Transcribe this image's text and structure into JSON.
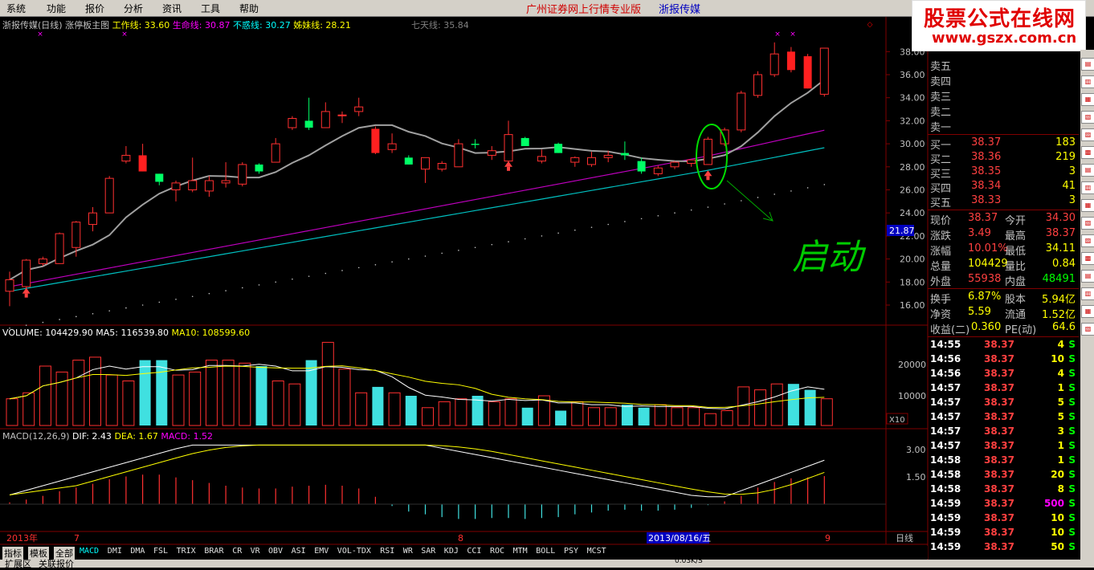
{
  "menu": [
    "系统",
    "功能",
    "报价",
    "分析",
    "资讯",
    "工具",
    "帮助"
  ],
  "banner": "广州证券网上行情专业版",
  "stock_title": "浙报传媒",
  "watermark": {
    "line1": "股票公式在线网",
    "line2": "www.gszx.com.cn"
  },
  "main_header": {
    "name": "浙报传媒(日线)",
    "indicator": "涨停板主图",
    "items": [
      {
        "label": "工作线: 33.60",
        "color": "#ffff00"
      },
      {
        "label": "生命线: 30.87",
        "color": "#ff00ff"
      },
      {
        "label": "不惑线: 30.27",
        "color": "#00ffff"
      },
      {
        "label": "姊妹线: 28.21",
        "color": "#ffff00"
      },
      {
        "label": "七天线: 35.84",
        "color": "#808080"
      }
    ]
  },
  "price_axis": [
    "38.00",
    "36.00",
    "34.00",
    "32.00",
    "30.00",
    "28.00",
    "26.00",
    "24.00",
    "22.00",
    "20.00",
    "18.00",
    "16.00"
  ],
  "price_marker": "21.87",
  "annotation": "启动",
  "volume_header": {
    "label": "VOLUME: 104429.90",
    "ma5": "MA5: 116539.80",
    "ma10": "MA10: 108599.60"
  },
  "volume_axis": [
    "20000",
    "10000"
  ],
  "volume_unit": "X10",
  "macd_header": {
    "label": "MACD(12,26,9)",
    "dif": "DIF: 2.43",
    "dea": "DEA: 1.67",
    "macd": "MACD: 1.52"
  },
  "macd_axis": [
    "3.00",
    "1.50"
  ],
  "date_axis": {
    "year": "2013年",
    "m7": "7",
    "m8": "8",
    "m9": "9",
    "cursor": "2013/08/16/五",
    "period": "日线"
  },
  "tabs": [
    "指标",
    "模板",
    "全部",
    "MACD",
    "DMI",
    "DMA",
    "FSL",
    "TRIX",
    "BRAR",
    "CR",
    "VR",
    "OBV",
    "ASI",
    "EMV",
    "VOL-TDX",
    "RSI",
    "WR",
    "SAR",
    "KDJ",
    "CCI",
    "ROC",
    "MTM",
    "BOLL",
    "PSY",
    "MCST"
  ],
  "order_book": {
    "sell": [
      "卖五",
      "卖四",
      "卖三",
      "卖二",
      "卖一"
    ],
    "buy": [
      {
        "label": "买一",
        "price": "38.37",
        "vol": "183"
      },
      {
        "label": "买二",
        "price": "38.36",
        "vol": "219"
      },
      {
        "label": "买三",
        "price": "38.35",
        "vol": "3"
      },
      {
        "label": "买四",
        "price": "38.34",
        "vol": "41"
      },
      {
        "label": "买五",
        "price": "38.33",
        "vol": "3"
      }
    ]
  },
  "quote": [
    {
      "l1": "现价",
      "v1": "38.37",
      "l2": "今开",
      "v2": "34.30"
    },
    {
      "l1": "涨跌",
      "v1": "3.49",
      "l2": "最高",
      "v2": "38.37"
    },
    {
      "l1": "涨幅",
      "v1": "10.01%",
      "l2": "最低",
      "v2": "34.11"
    },
    {
      "l1": "总量",
      "v1": "104429",
      "l2": "量比",
      "v2": "0.84"
    },
    {
      "l1": "外盘",
      "v1": "55938",
      "l2": "内盘",
      "v2": "48491"
    },
    {
      "l1": "换手",
      "v1": "6.87%",
      "l2": "股本",
      "v2": "5.94亿"
    },
    {
      "l1": "净资",
      "v1": "5.59",
      "l2": "流通",
      "v2": "1.52亿"
    },
    {
      "l1": "收益(二)",
      "v1": "0.360",
      "l2": "PE(动)",
      "v2": "64.6"
    }
  ],
  "ticks": [
    {
      "t": "14:55",
      "p": "38.37",
      "v": "4",
      "s": "S"
    },
    {
      "t": "14:56",
      "p": "38.37",
      "v": "10",
      "s": "S"
    },
    {
      "t": "14:56",
      "p": "38.37",
      "v": "4",
      "s": "S"
    },
    {
      "t": "14:57",
      "p": "38.37",
      "v": "1",
      "s": "S"
    },
    {
      "t": "14:57",
      "p": "38.37",
      "v": "5",
      "s": "S"
    },
    {
      "t": "14:57",
      "p": "38.37",
      "v": "5",
      "s": "S"
    },
    {
      "t": "14:57",
      "p": "38.37",
      "v": "3",
      "s": "S"
    },
    {
      "t": "14:57",
      "p": "38.37",
      "v": "1",
      "s": "S"
    },
    {
      "t": "14:58",
      "p": "38.37",
      "v": "1",
      "s": "S"
    },
    {
      "t": "14:58",
      "p": "38.37",
      "v": "20",
      "s": "S"
    },
    {
      "t": "14:58",
      "p": "38.37",
      "v": "8",
      "s": "S"
    },
    {
      "t": "14:59",
      "p": "38.37",
      "v": "500",
      "s": "S"
    },
    {
      "t": "14:59",
      "p": "38.37",
      "v": "10",
      "s": "S"
    },
    {
      "t": "14:59",
      "p": "38.37",
      "v": "10",
      "s": "S"
    },
    {
      "t": "14:59",
      "p": "38.37",
      "v": "50",
      "s": "S"
    }
  ],
  "bottom": {
    "left1": "扩展区",
    "left2": "关联报价",
    "speed": "0.03K/S"
  },
  "candles": [
    [
      17.2,
      18.2,
      15.9,
      18.9
    ],
    [
      17.6,
      19.9,
      17.4,
      20.0
    ],
    [
      19.6,
      20.0,
      19.4,
      20.2
    ],
    [
      19.6,
      22.2,
      19.6,
      22.3
    ],
    [
      21.0,
      23.2,
      20.2,
      23.3
    ],
    [
      23.0,
      24.0,
      22.4,
      24.5
    ],
    [
      24.0,
      27.0,
      24.0,
      27.2
    ],
    [
      28.5,
      29.0,
      28.3,
      29.8
    ],
    [
      29.0,
      27.6,
      27.6,
      30.0
    ],
    [
      27.4,
      26.7,
      26.4,
      27.4
    ],
    [
      26.0,
      26.6,
      25.0,
      26.8
    ],
    [
      26.0,
      26.8,
      25.8,
      28.8
    ],
    [
      25.9,
      26.8,
      25.4,
      27.2
    ],
    [
      26.6,
      26.8,
      26.2,
      28.4
    ],
    [
      26.5,
      28.2,
      26.3,
      28.4
    ],
    [
      28.2,
      27.6,
      27.4,
      28.3
    ],
    [
      28.4,
      30.0,
      28.4,
      30.5
    ],
    [
      31.4,
      32.2,
      31.2,
      32.4
    ],
    [
      32.0,
      31.4,
      31.2,
      34.0
    ],
    [
      31.4,
      32.8,
      31.4,
      33.6
    ],
    [
      32.5,
      32.5,
      31.8,
      32.8
    ],
    [
      32.8,
      33.2,
      32.4,
      34.0
    ],
    [
      31.3,
      29.2,
      29.1,
      31.5
    ],
    [
      29.5,
      30.0,
      29.2,
      30.9
    ],
    [
      28.8,
      28.2,
      28.2,
      29.0
    ],
    [
      27.8,
      28.8,
      26.6,
      28.8
    ],
    [
      27.8,
      28.3,
      27.6,
      28.5
    ],
    [
      28.0,
      30.0,
      28.0,
      30.4
    ],
    [
      30.0,
      29.9,
      29.6,
      30.4
    ],
    [
      29.0,
      29.4,
      28.6,
      29.8
    ],
    [
      28.5,
      30.8,
      28.3,
      32.0
    ],
    [
      30.5,
      29.8,
      29.8,
      30.6
    ],
    [
      28.5,
      28.9,
      28.3,
      29.5
    ],
    [
      30.0,
      29.2,
      29.2,
      30.1
    ],
    [
      28.4,
      28.8,
      28.0,
      28.9
    ],
    [
      28.2,
      28.8,
      28.0,
      29.3
    ],
    [
      28.8,
      29.0,
      28.4,
      29.4
    ],
    [
      29.2,
      29.0,
      28.6,
      30.2
    ],
    [
      28.5,
      27.6,
      27.4,
      28.8
    ],
    [
      27.4,
      27.9,
      27.2,
      28.1
    ],
    [
      28.0,
      28.4,
      27.8,
      28.5
    ],
    [
      28.3,
      28.6,
      28.0,
      28.6
    ],
    [
      28.2,
      30.4,
      28.2,
      30.6
    ],
    [
      30.0,
      31.2,
      29.8,
      31.4
    ],
    [
      31.2,
      34.4,
      31.0,
      34.6
    ],
    [
      34.2,
      36.0,
      34.0,
      36.3
    ],
    [
      36.0,
      37.8,
      35.8,
      38.8
    ],
    [
      38.0,
      36.4,
      36.2,
      38.4
    ],
    [
      37.6,
      34.8,
      34.8,
      37.8
    ],
    [
      34.3,
      38.3,
      34.1,
      38.3
    ]
  ],
  "volumes": [
    9,
    11,
    20,
    18,
    22,
    23,
    17,
    15,
    22,
    22,
    17,
    18,
    22,
    22,
    21,
    20,
    15,
    14,
    22,
    28,
    19,
    11,
    13,
    11,
    10,
    6,
    8,
    9,
    10,
    8,
    9,
    6,
    10,
    5,
    8,
    6,
    6,
    7,
    6,
    7,
    6,
    6,
    4,
    5,
    13,
    12,
    14,
    14,
    12,
    9,
    10
  ],
  "macd_bars": [
    0.1,
    0.25,
    0.45,
    0.7,
    0.9,
    1.1,
    1.35,
    1.5,
    1.6,
    1.6,
    1.45,
    1.3,
    1.15,
    1.0,
    0.9,
    0.85,
    0.85,
    0.95,
    1.0,
    1.05,
    1.0,
    0.85,
    0.4,
    -0.1,
    -0.4,
    -0.55,
    -0.7,
    -0.8,
    -0.8,
    -0.75,
    -0.75,
    -0.8,
    -0.75,
    -0.7,
    -0.55,
    -0.45,
    -0.35,
    -0.3,
    -0.35,
    -0.35,
    -0.3,
    -0.2,
    -0.05,
    0.15,
    0.45,
    0.9,
    1.2,
    1.4,
    1.45,
    1.52
  ]
}
